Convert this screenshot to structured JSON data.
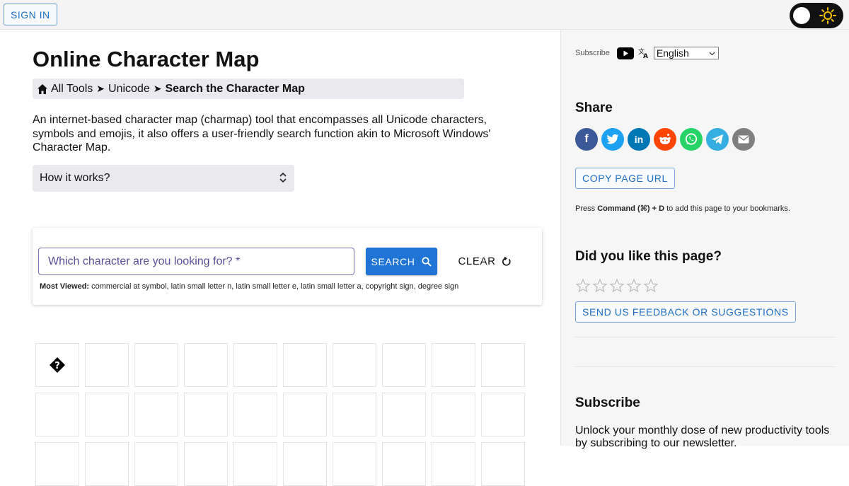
{
  "header": {
    "signin_label": "SIGN IN"
  },
  "main": {
    "title": "Online Character Map",
    "breadcrumb": {
      "items": [
        "All Tools",
        "Unicode"
      ],
      "separator": "➤",
      "current": "Search the Character Map"
    },
    "intro": "An internet-based character map (charmap) tool that encompasses all Unicode characters, symbols and emojis, it also offers a user-friendly search function akin to Microsoft Windows' Character Map.",
    "how_it_works": "How it works?",
    "search": {
      "placeholder": "Which character are you looking for? *",
      "search_label": "SEARCH",
      "clear_label": "CLEAR",
      "most_viewed_label": "Most Viewed:",
      "most_viewed": [
        "commercial at symbol",
        "latin small letter n",
        "latin small letter e",
        "latin small letter a",
        "copyright sign",
        "degree sign"
      ]
    },
    "grid": {
      "first_char": "�",
      "visible_cells": 30
    }
  },
  "sidebar": {
    "subscribe_label": "Subscribe",
    "language": "English",
    "share_heading": "Share",
    "share_buttons": [
      {
        "name": "facebook",
        "color": "#3b5998",
        "glyph": "f"
      },
      {
        "name": "twitter",
        "color": "#1da1f2",
        "glyph": ""
      },
      {
        "name": "linkedin",
        "color": "#0077b5",
        "glyph": "in"
      },
      {
        "name": "reddit",
        "color": "#ff4500",
        "glyph": ""
      },
      {
        "name": "whatsapp",
        "color": "#25d366",
        "glyph": ""
      },
      {
        "name": "telegram",
        "color": "#37aee2",
        "glyph": ""
      },
      {
        "name": "email",
        "color": "#7f7f7f",
        "glyph": ""
      }
    ],
    "copy_url_label": "COPY PAGE URL",
    "bookmark_prefix": "Press ",
    "bookmark_keys": "Command (⌘) + D",
    "bookmark_suffix": " to add this page to your bookmarks.",
    "rating_heading": "Did you like this page?",
    "rating": {
      "value": 0,
      "max": 5
    },
    "feedback_label": "SEND US FEEDBACK OR SUGGESTIONS",
    "subscribe_heading": "Subscribe",
    "subscribe_text": "Unlock your monthly dose of new productivity tools by subscribing to our newsletter."
  },
  "colors": {
    "accent": "#1f74d6",
    "link_outline": "#7ba4d6"
  }
}
